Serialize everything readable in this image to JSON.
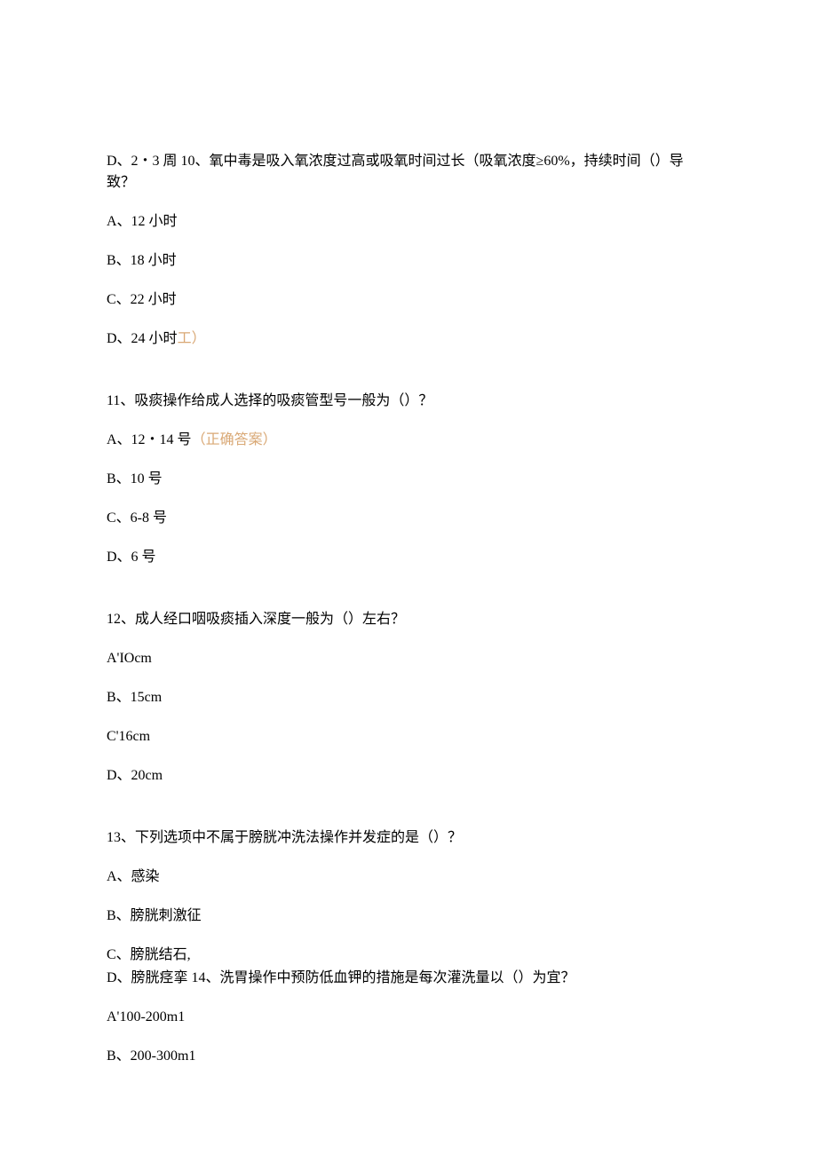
{
  "lines": {
    "line1": "D、2・3 周 10、氧中毒是吸入氧浓度过高或吸氧时间过长（吸氧浓度≥60%，持续时间（）导致？",
    "line2": "A、12 小时",
    "line3": "B、18 小时",
    "line4": "C、22 小时",
    "line5a": "D、24 小时",
    "line5b": "工）",
    "line6": "11、吸痰操作给成人选择的吸痰管型号一般为（）？",
    "line7a": "A、12・14 号",
    "line7b": "（正确答案）",
    "line8": "B、10 号",
    "line9": "C、6-8 号",
    "line10": "D、6 号",
    "line11": "12、成人经口咽吸痰插入深度一般为（）左右？",
    "line12": "A'IOcm",
    "line13": "B、15cm",
    "line14": "C'16cm",
    "line15": "D、20cm",
    "line16": "13、下列选项中不属于膀胱冲洗法操作并发症的是（）？",
    "line17": "A、感染",
    "line18": "B、膀胱刺激征",
    "line19": "C、膀胱结石,",
    "line20": "D、膀胱痉挛 14、洗胃操作中预防低血钾的措施是每次灌洗量以（）为宜？",
    "line21": "A'100-200m1",
    "line22": "B、200-300m1"
  }
}
